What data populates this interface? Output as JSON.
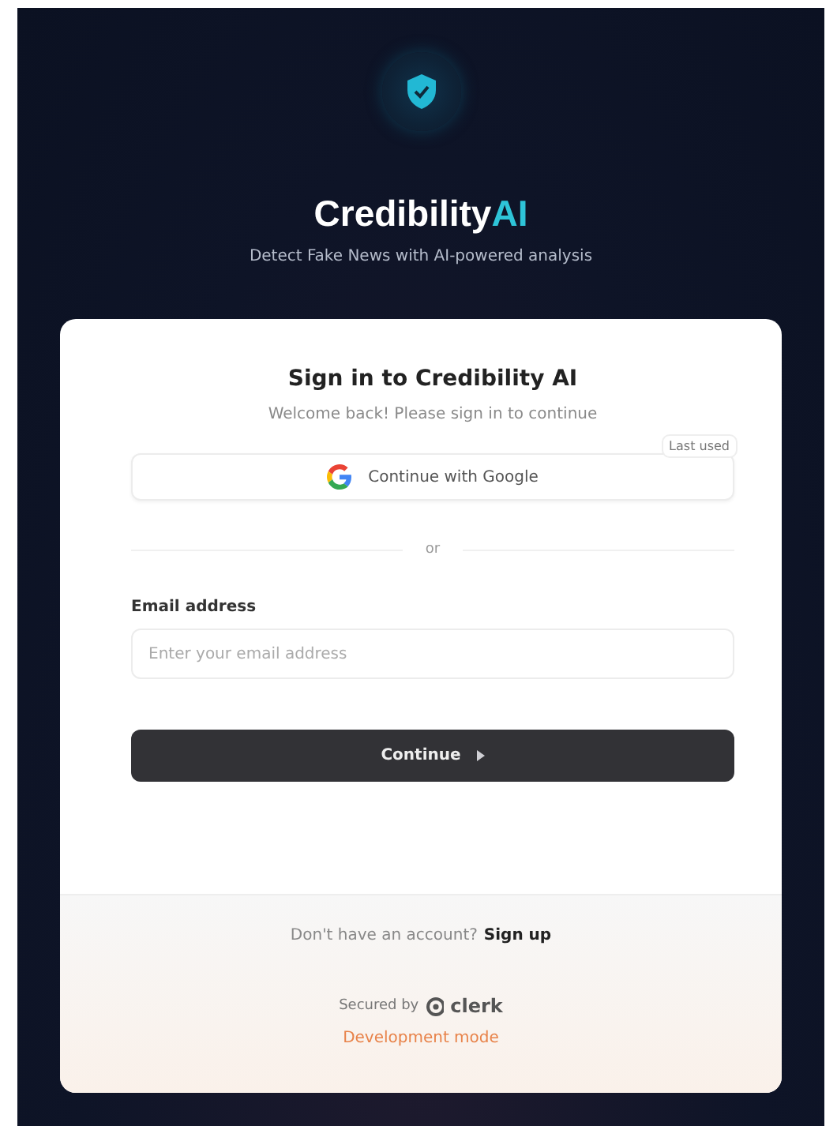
{
  "brand": {
    "name": "Credibility",
    "accent": "AI",
    "tagline": "Detect Fake News with AI-powered analysis"
  },
  "card": {
    "title": "Sign in to Credibility AI",
    "subtitle": "Welcome back! Please sign in to continue",
    "social": [
      {
        "kind": "google",
        "label": "Continue with Google",
        "badge": "Last used"
      }
    ],
    "divider": "or",
    "fields": [
      {
        "label": "Email address",
        "placeholder": "Enter your email address"
      }
    ],
    "submit": "Continue",
    "footer": {
      "prompt": "Don't have an account?",
      "link": "Sign up",
      "secured": "Secured by",
      "provider": "clerk",
      "mode": "Development mode"
    }
  }
}
